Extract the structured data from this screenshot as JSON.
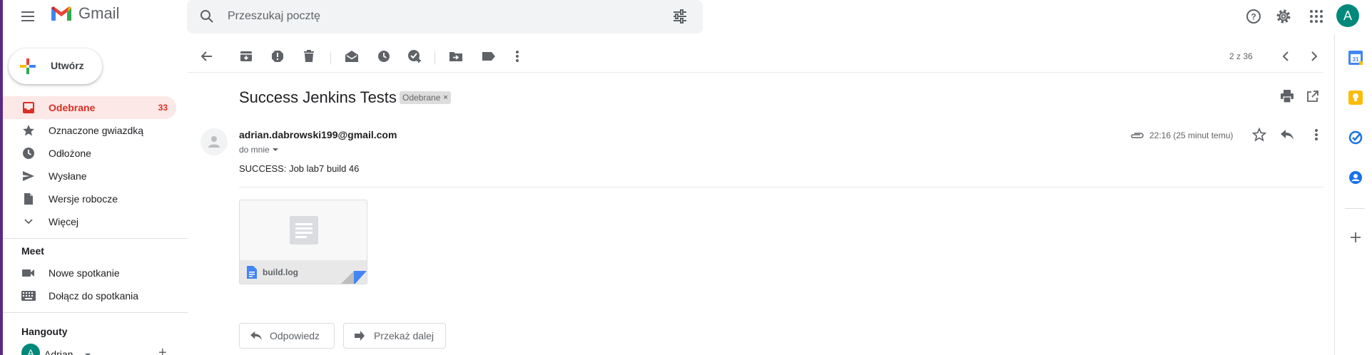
{
  "app": {
    "name": "Gmail"
  },
  "search": {
    "placeholder": "Przeszukaj pocztę"
  },
  "header": {
    "avatar_letter": "A"
  },
  "compose": {
    "label": "Utwórz"
  },
  "sidebar": {
    "items": [
      {
        "label": "Odebrane",
        "count": "33",
        "icon": "inbox-icon",
        "active": true
      },
      {
        "label": "Oznaczone gwiazdką",
        "icon": "star-icon"
      },
      {
        "label": "Odłożone",
        "icon": "clock-icon"
      },
      {
        "label": "Wysłane",
        "icon": "send-icon"
      },
      {
        "label": "Wersje robocze",
        "icon": "draft-icon"
      },
      {
        "label": "Więcej",
        "icon": "chevron-down-icon"
      }
    ],
    "meet": {
      "title": "Meet",
      "items": [
        {
          "label": "Nowe spotkanie",
          "icon": "video-icon"
        },
        {
          "label": "Dołącz do spotkania",
          "icon": "keyboard-icon"
        }
      ]
    },
    "hangouts": {
      "title": "Hangouty",
      "user": "Adrian",
      "avatar_letter": "A"
    }
  },
  "toolbar": {
    "pager": "2 z 36"
  },
  "message": {
    "subject": "Success Jenkins Tests",
    "label": "Odebrane",
    "sender": "adrian.dabrowski199@gmail.com",
    "to": "do mnie",
    "time": "22:16 (25 minut temu)",
    "body": "SUCCESS: Job lab7 build 46",
    "attachment": {
      "name": "build.log"
    }
  },
  "actions": {
    "reply": "Odpowiedz",
    "forward": "Przekaż dalej"
  },
  "colors": {
    "accent_red": "#d93025",
    "active_bg": "#fce8e6",
    "avatar": "#00897b"
  }
}
